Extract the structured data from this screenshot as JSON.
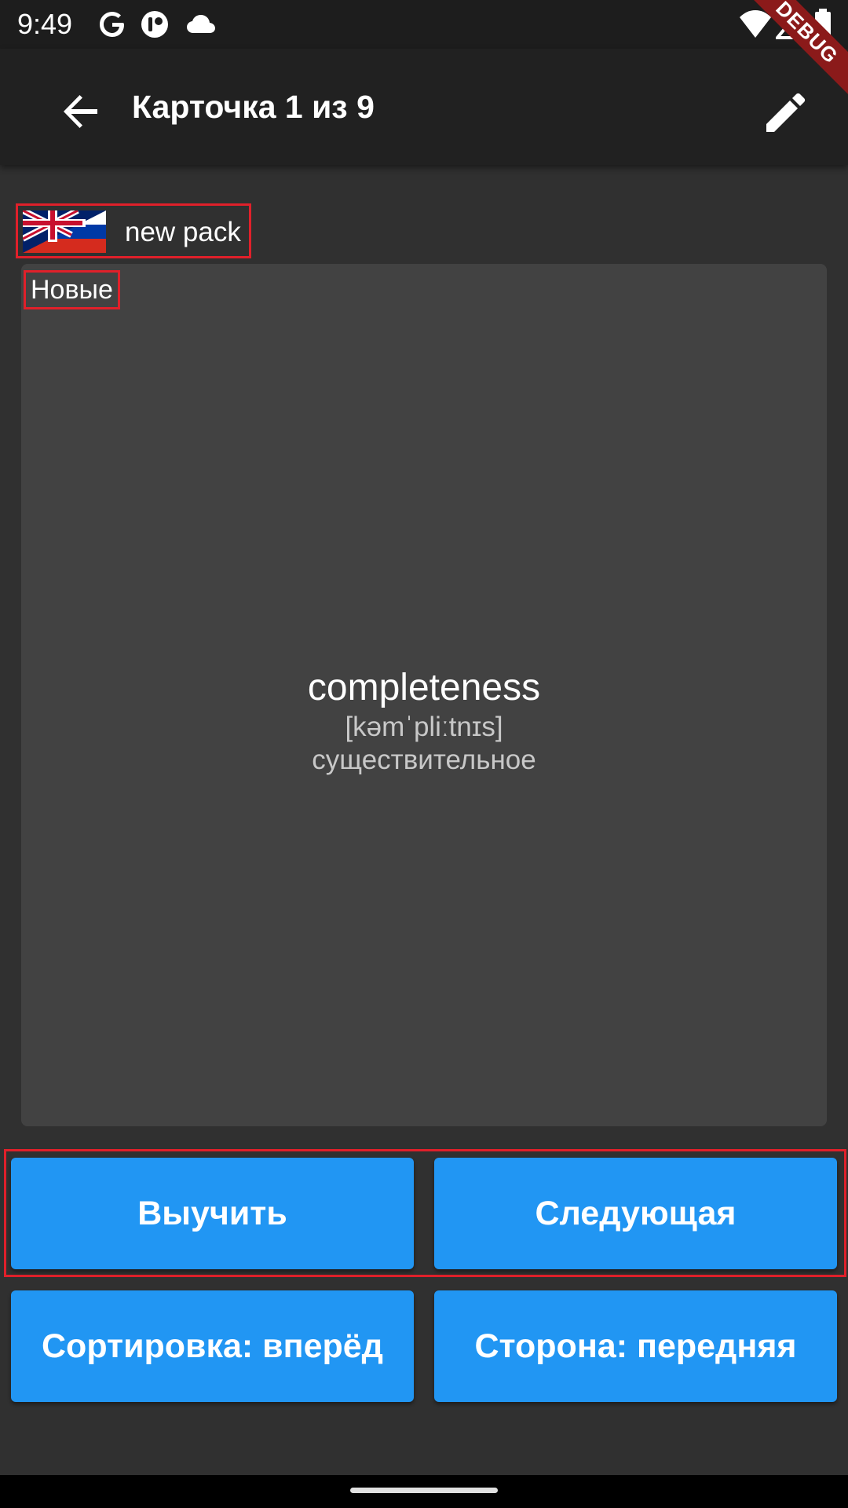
{
  "status_bar": {
    "time": "9:49",
    "left_icons": [
      "google-icon",
      "app-notification-icon",
      "cloud-icon"
    ],
    "right_icons": [
      "wifi-icon",
      "signal-icon",
      "battery-icon"
    ]
  },
  "debug_banner": "DEBUG",
  "app_bar": {
    "title": "Карточка 1 из 9",
    "back_icon": "arrow-back-icon",
    "edit_icon": "pencil-icon"
  },
  "pack": {
    "flag": "en-ru-flag-icon",
    "name": "new pack"
  },
  "card": {
    "status": "Новые",
    "word": "completeness",
    "transcription": "[kəmˈpliːtnɪs]",
    "part_of_speech": "существительное"
  },
  "buttons": {
    "learn": "Выучить",
    "next": "Следующая",
    "sort": "Сортировка: вперёд",
    "side": "Сторона: передняя"
  },
  "colors": {
    "accent": "#2196f3",
    "background": "#303030",
    "app_bar": "#212121",
    "card": "#424242",
    "highlight": "#e0202a"
  }
}
